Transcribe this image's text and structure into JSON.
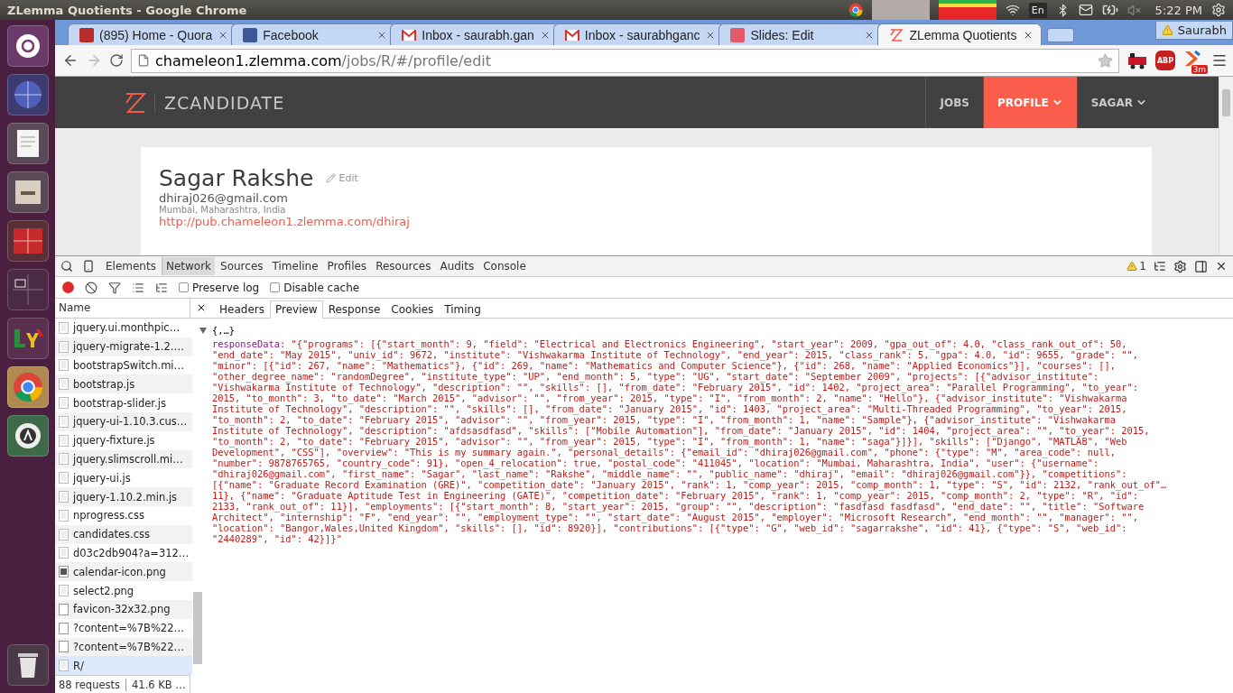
{
  "top_panel": {
    "title": "ZLemma Quotients - Google Chrome",
    "keyboard": "En",
    "clock": "5:22 PM"
  },
  "tabs": [
    {
      "title": "(895) Home - Quora",
      "kind": "quora",
      "selected": false
    },
    {
      "title": "Facebook",
      "kind": "facebook",
      "selected": false
    },
    {
      "title": "Inbox - saurabh.gan",
      "kind": "gmail",
      "selected": false
    },
    {
      "title": "Inbox - saurabhganc",
      "kind": "gmail",
      "selected": false
    },
    {
      "title": "Slides: Edit",
      "kind": "slides",
      "selected": false
    },
    {
      "title": "ZLemma Quotients",
      "kind": "zlemma",
      "selected": true
    }
  ],
  "profile": {
    "name": "Saurabh"
  },
  "address": {
    "host": "chameleon1.zlemma.com",
    "path": "/jobs/R/#/profile/edit"
  },
  "extensions": [
    {
      "kind": "train"
    },
    {
      "kind": "abp",
      "label": "ABP"
    },
    {
      "kind": "chevron",
      "badge": "3m"
    }
  ],
  "site": {
    "brand": "ZCANDIDATE",
    "nav": [
      {
        "label": "JOBS",
        "selected": false,
        "dropdown": false
      },
      {
        "label": "PROFILE",
        "selected": true,
        "dropdown": true
      },
      {
        "label": "SAGAR",
        "selected": false,
        "dropdown": true
      }
    ]
  },
  "profile_card": {
    "name": "Sagar Rakshe",
    "edit": "Edit",
    "email": "dhiraj026@gmail.com",
    "location": "Mumbai, Maharashtra, India",
    "url": "http://pub.chameleon1.zlemma.com/dhiraj"
  },
  "devtools": {
    "panels": [
      {
        "label": "Elements",
        "selected": false
      },
      {
        "label": "Network",
        "selected": true
      },
      {
        "label": "Sources",
        "selected": false
      },
      {
        "label": "Timeline",
        "selected": false
      },
      {
        "label": "Profiles",
        "selected": false
      },
      {
        "label": "Resources",
        "selected": false
      },
      {
        "label": "Audits",
        "selected": false
      },
      {
        "label": "Console",
        "selected": false
      }
    ],
    "warnings": "1",
    "network": {
      "recording": true,
      "preserve_log": {
        "label": "Preserve log",
        "checked": false
      },
      "disable_cache": {
        "label": "Disable cache",
        "checked": false
      },
      "name_header": "Name",
      "files": [
        {
          "name": "jquery.ui.monthpic…",
          "kind": "doc",
          "selected": false
        },
        {
          "name": "jquery-migrate-1.2.…",
          "kind": "doc",
          "selected": false
        },
        {
          "name": "bootstrapSwitch.mi…",
          "kind": "doc",
          "selected": false
        },
        {
          "name": "bootstrap.js",
          "kind": "doc",
          "selected": false
        },
        {
          "name": "bootstrap-slider.js",
          "kind": "doc",
          "selected": false
        },
        {
          "name": "jquery-ui-1.10.3.cus…",
          "kind": "doc",
          "selected": false
        },
        {
          "name": "jquery-fixture.js",
          "kind": "doc",
          "selected": false
        },
        {
          "name": "jquery.slimscroll.mi…",
          "kind": "doc",
          "selected": false
        },
        {
          "name": "jquery-ui.js",
          "kind": "doc",
          "selected": false
        },
        {
          "name": "jquery-1.10.2.min.js",
          "kind": "doc",
          "selected": false
        },
        {
          "name": "nprogress.css",
          "kind": "doc",
          "selected": false
        },
        {
          "name": "candidates.css",
          "kind": "doc",
          "selected": false
        },
        {
          "name": "d03c2db904?a=312…",
          "kind": "doc",
          "selected": false
        },
        {
          "name": "calendar-icon.png",
          "kind": "calendar",
          "selected": false
        },
        {
          "name": "select2.png",
          "kind": "doc",
          "selected": false
        },
        {
          "name": "favicon-32x32.png",
          "kind": "blank",
          "selected": false
        },
        {
          "name": "?content=%7B%22…",
          "kind": "blank",
          "selected": false
        },
        {
          "name": "?content=%7B%22…",
          "kind": "blank",
          "selected": false
        },
        {
          "name": "R/",
          "kind": "doc",
          "selected": true
        }
      ],
      "status": [
        "88 requests",
        "41.6 KB …"
      ]
    },
    "detail_tabs": [
      {
        "label": "Headers",
        "selected": false
      },
      {
        "label": "Preview",
        "selected": true
      },
      {
        "label": "Response",
        "selected": false
      },
      {
        "label": "Cookies",
        "selected": false
      },
      {
        "label": "Timing",
        "selected": false
      }
    ],
    "preview": {
      "summary": "{,…}",
      "expanded": true,
      "key": "responseData:",
      "lines": [
        "\"{\"programs\": [{\"start_month\": 9, \"field\": \"Electrical and Electronics Engineering\", \"start_year\": 2009, \"gpa_out_of\": 4.0, \"class_rank_out_of\": 50,",
        "\"end_date\": \"May 2015\", \"univ_id\": 9672, \"institute\": \"Vishwakarma Institute of Technology\", \"end_year\": 2015, \"class_rank\": 5, \"gpa\": 4.0, \"id\": 9655, \"grade\": \"\",",
        "\"minor\": [{\"id\": 267, \"name\": \"Mathematics\"}, {\"id\": 269, \"name\": \"Mathematics and Computer Science\"}, {\"id\": 268, \"name\": \"Applied Economics\"}], \"courses\": [],",
        "\"other_degree_name\": \"randomDegree\", \"institute_type\": \"UP\", \"end_month\": 5, \"type\": \"UG\", \"start_date\": \"September 2009\", \"projects\": [{\"advisor_institute\":",
        "\"Vishwakarma Institute of Technology\", \"description\": \"\", \"skills\": [], \"from_date\": \"February 2015\", \"id\": 1402, \"project_area\": \"Parallel Programming\", \"to_year\":",
        "2015, \"to_month\": 3, \"to_date\": \"March 2015\", \"advisor\": \"\", \"from_year\": 2015, \"type\": \"I\", \"from_month\": 2, \"name\": \"Hello\"}, {\"advisor_institute\": \"Vishwakarma",
        "Institute of Technology\", \"description\": \"\", \"skills\": [], \"from_date\": \"January 2015\", \"id\": 1403, \"project_area\": \"Multi-Threaded Programming\", \"to_year\": 2015,",
        "\"to_month\": 2, \"to_date\": \"February 2015\", \"advisor\": \"\", \"from_year\": 2015, \"type\": \"I\", \"from_month\": 1, \"name\": \"Sample\"}, {\"advisor_institute\": \"Vishwakarma",
        "Institute of Technology\", \"description\": \"afdsasdfasd\", \"skills\": [\"Mobile Automation\"], \"from_date\": \"January 2015\", \"id\": 1404, \"project_area\": \"\", \"to_year\": 2015,",
        "\"to_month\": 2, \"to_date\": \"February 2015\", \"advisor\": \"\", \"from_year\": 2015, \"type\": \"I\", \"from_month\": 1, \"name\": \"saga\"}]}], \"skills\": [\"Django\", \"MATLAB\", \"Web",
        "Development\", \"CSS\"], \"overview\": \"This is my summary again.\", \"personal_details\": {\"email_id\": \"dhiraj026@gmail.com\", \"phone\": {\"type\": \"M\", \"area_code\": null,",
        "\"number\": 9878765765, \"country_code\": 91}, \"open_4_relocation\": true, \"postal_code\": \"411045\", \"location\": \"Mumbai, Maharashtra, India\", \"user\": {\"username\":",
        "\"dhiraj026@gmail.com\", \"first_name\": \"Sagar\", \"last_name\": \"Rakshe\", \"middle_name\": \"\", \"public_name\": \"dhiraj\", \"email\": \"dhiraj026@gmail.com\"}}, \"competitions\":",
        "[{\"name\": \"Graduate Record Examination (GRE)\", \"competition_date\": \"January 2015\", \"rank\": 1, \"comp_year\": 2015, \"comp_month\": 1, \"type\": \"S\", \"id\": 2132, \"rank_out_of\"…",
        "11}, {\"name\": \"Graduate Aptitude Test in Engineering (GATE)\", \"competition_date\": \"February 2015\", \"rank\": 1, \"comp_year\": 2015, \"comp_month\": 2, \"type\": \"R\", \"id\":",
        "2133, \"rank_out_of\": 11}], \"employments\": [{\"start_month\": 8, \"start_year\": 2015, \"group\": \"\", \"description\": \"fasdfasd fasdfasd\", \"end_date\": \"\", \"title\": \"Software",
        "Architect\", \"internship\": \"F\", \"end_year\": \"\", \"employment_type\": \"\", \"start_date\": \"August 2015\", \"employer\": \"Microsoft Research\", \"end_month\": \"\", \"manager\": \"\",",
        "\"location\": \"Bangor,Wales,United Kingdom\", \"skills\": [], \"id\": 8920}], \"contributions\": [{\"type\": \"G\", \"web_id\": \"sagarrakshe\", \"id\": 41}, {\"type\": \"S\", \"web_id\":",
        "\"2440289\", \"id\": 42}]}\""
      ]
    }
  }
}
